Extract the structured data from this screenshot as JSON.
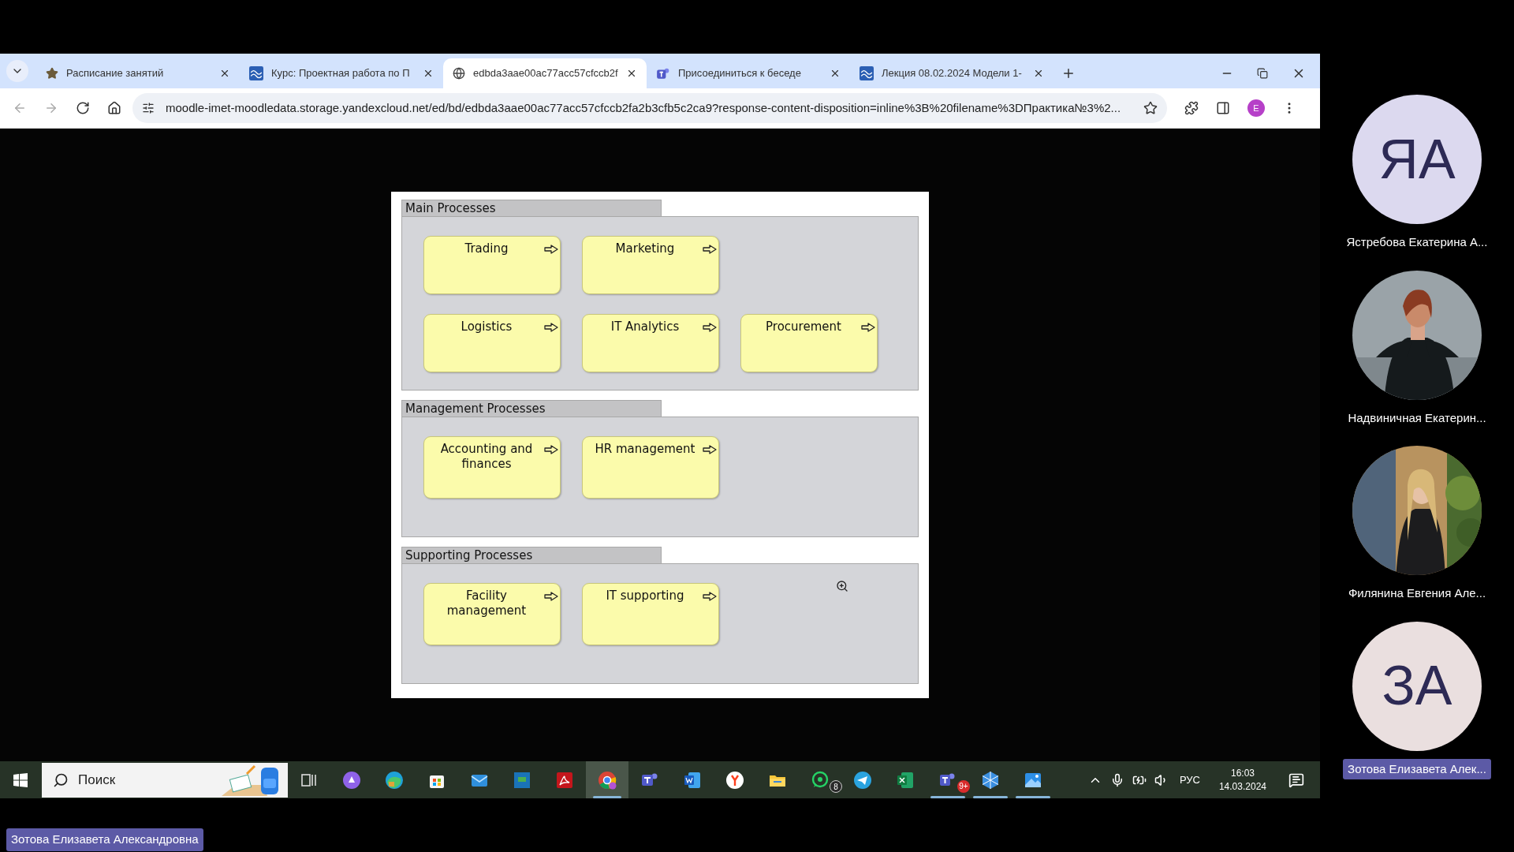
{
  "browser": {
    "tabs": [
      {
        "title": "Расписание занятий",
        "kind": "star",
        "selected": false
      },
      {
        "title": "Курс: Проектная работа по П",
        "kind": "wave",
        "selected": false
      },
      {
        "title": "edbda3aae00ac77acc57cfccb2f",
        "kind": "globe",
        "selected": true
      },
      {
        "title": "Присоединиться к беседе",
        "kind": "teams",
        "selected": false
      },
      {
        "title": "Лекция 08.02.2024 Модели 1-",
        "kind": "wave",
        "selected": false
      }
    ],
    "address": "moodle-imet-moodledata.storage.yandexcloud.net/ed/bd/edbda3aae00ac77acc57cfccb2fa2b3cfb5c2ca9?response-content-disposition=inline%3B%20filename%3DПрактика№3%2...",
    "profile_initial": "E"
  },
  "diagram": {
    "groups": [
      {
        "title": "Main Processes",
        "rows": [
          [
            {
              "label": "Trading"
            },
            {
              "label": "Marketing"
            }
          ],
          [
            {
              "label": "Logistics"
            },
            {
              "label": "IT Analytics"
            },
            {
              "label": "Procurement"
            }
          ]
        ]
      },
      {
        "title": "Management Processes",
        "rows": [
          [
            {
              "label": "Accounting and finances"
            },
            {
              "label": "HR management"
            }
          ]
        ]
      },
      {
        "title": "Supporting Processes",
        "rows": [
          [
            {
              "label": "Facility management"
            },
            {
              "label": "IT supporting"
            }
          ]
        ]
      }
    ]
  },
  "participants": [
    {
      "name": "Ястребова Екатерина А...",
      "kind": "initials",
      "initials": "ЯА",
      "color": "#dcd9ef",
      "speaking": false
    },
    {
      "name": "Надвиничная Екатерин...",
      "kind": "picture",
      "speaking": false
    },
    {
      "name": "Филянина Евгения Але...",
      "kind": "picture",
      "speaking": false
    },
    {
      "name": "Зотова Елизавета Алек...",
      "kind": "initials",
      "initials": "ЗА",
      "color": "#eadfdf",
      "speaking": true
    }
  ],
  "presenter_label": "Зотова Елизавета Александровна",
  "taskbar": {
    "search_placeholder": "Поиск",
    "apps": [
      {
        "kind": "taskview",
        "running": false,
        "selected": false
      },
      {
        "kind": "alice",
        "running": false,
        "selected": false
      },
      {
        "kind": "edge",
        "running": false,
        "selected": false
      },
      {
        "kind": "store",
        "running": false,
        "selected": false
      },
      {
        "kind": "mail",
        "running": false,
        "selected": false
      },
      {
        "kind": "sheet",
        "running": false,
        "selected": false
      },
      {
        "kind": "acrobat",
        "running": false,
        "selected": false
      },
      {
        "kind": "chrome",
        "running": true,
        "selected": true
      },
      {
        "kind": "teams",
        "running": false,
        "selected": false
      },
      {
        "kind": "word",
        "running": false,
        "selected": false
      },
      {
        "kind": "yandex",
        "running": false,
        "selected": false
      },
      {
        "kind": "folder",
        "running": false,
        "selected": false
      },
      {
        "kind": "whatsapp",
        "running": false,
        "selected": false,
        "badge": "8"
      },
      {
        "kind": "telegram",
        "running": false,
        "selected": false
      },
      {
        "kind": "excel",
        "running": false,
        "selected": false
      },
      {
        "kind": "teams2",
        "running": true,
        "selected": false,
        "badge": "9+"
      },
      {
        "kind": "hex",
        "running": true,
        "selected": false
      },
      {
        "kind": "photos",
        "running": true,
        "selected": false
      }
    ],
    "language": "РУС",
    "time": "16:03",
    "date": "14.03.2024"
  }
}
